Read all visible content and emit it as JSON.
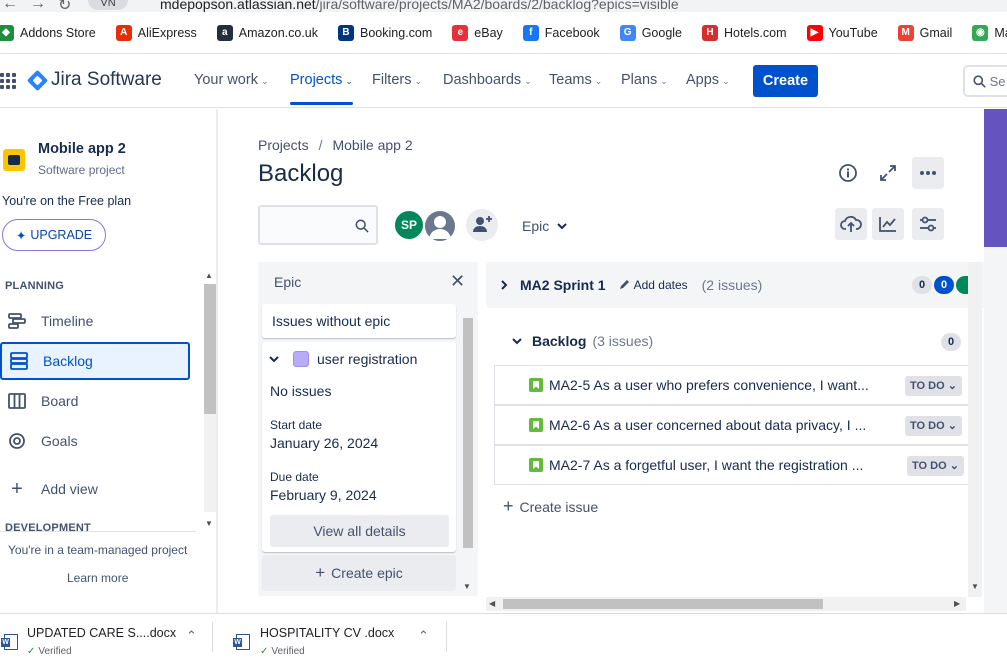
{
  "browser": {
    "url_host": "mdepopson.atlassian.net",
    "url_path": "/jira/software/projects/MA2/boards/2/backlog?epics=visible",
    "profile_label": "VN",
    "bookmarks": [
      {
        "label": "Addons Store",
        "icon": "addons-icon",
        "color": "#1e8e3e"
      },
      {
        "label": "AliExpress",
        "icon": "aliexpress-icon",
        "color": "#e62e04"
      },
      {
        "label": "Amazon.co.uk",
        "icon": "amazon-icon",
        "color": "#232f3e"
      },
      {
        "label": "Booking.com",
        "icon": "booking-icon",
        "color": "#003580"
      },
      {
        "label": "eBay",
        "icon": "ebay-icon",
        "color": "#e53238"
      },
      {
        "label": "Facebook",
        "icon": "facebook-icon",
        "color": "#1877f2"
      },
      {
        "label": "Google",
        "icon": "google-icon",
        "color": "#4285f4"
      },
      {
        "label": "Hotels.com",
        "icon": "hotels-icon",
        "color": "#d32f2f"
      },
      {
        "label": "YouTube",
        "icon": "youtube-icon",
        "color": "#ff0000"
      },
      {
        "label": "Gmail",
        "icon": "gmail-icon",
        "color": "#ea4335"
      },
      {
        "label": "Maps",
        "icon": "maps-icon",
        "color": "#34a853"
      }
    ]
  },
  "topnav": {
    "product": "Jira Software",
    "items": [
      "Your work",
      "Projects",
      "Filters",
      "Dashboards",
      "Teams",
      "Plans",
      "Apps"
    ],
    "active": "Projects",
    "create_label": "Create",
    "search_placeholder": "Se"
  },
  "sidebar": {
    "project_name": "Mobile app 2",
    "project_type": "Software project",
    "plan_note": "You're on the Free plan",
    "upgrade_label": "UPGRADE",
    "planning_title": "PLANNING",
    "items": [
      {
        "label": "Timeline",
        "icon": "timeline-icon"
      },
      {
        "label": "Backlog",
        "icon": "backlog-icon"
      },
      {
        "label": "Board",
        "icon": "board-icon"
      },
      {
        "label": "Goals",
        "icon": "goals-icon"
      }
    ],
    "active": "Backlog",
    "add_view_label": "Add view",
    "development_title": "DEVELOPMENT",
    "team_note": "You're in a team-managed project",
    "learn_more": "Learn more"
  },
  "main": {
    "breadcrumb": [
      "Projects",
      "Mobile app 2"
    ],
    "title": "Backlog",
    "avatar_initials": "SP",
    "epic_filter_label": "Epic"
  },
  "epic_panel": {
    "title": "Epic",
    "issues_without_epic": "Issues without epic",
    "epic_name": "user registration",
    "epic_color": "#b8acf6",
    "no_issues": "No issues",
    "start_label": "Start date",
    "start_date": "January 26, 2024",
    "due_label": "Due date",
    "due_date": "February 9, 2024",
    "view_details": "View all details",
    "create_epic": "Create epic"
  },
  "sprint": {
    "name": "MA2 Sprint 1",
    "add_dates": "Add dates",
    "issue_count": "(2 issues)",
    "counts": [
      "0",
      "0"
    ]
  },
  "backlog": {
    "title": "Backlog",
    "issue_count": "(3 issues)",
    "count": "0",
    "issues": [
      {
        "summary": "MA2-5 As a user who prefers convenience, I want...",
        "status": "TO DO"
      },
      {
        "summary": "MA2-6 As a user concerned about data privacy, I ...",
        "status": "TO DO"
      },
      {
        "summary": "MA2-7 As a forgetful user, I want the registration ...",
        "status": "TO DO"
      }
    ],
    "create_issue": "Create issue"
  },
  "downloads": [
    {
      "name": "UPDATED CARE S....docx",
      "status": "Verified"
    },
    {
      "name": "HOSPITALITY CV .docx",
      "status": "Verified"
    }
  ]
}
